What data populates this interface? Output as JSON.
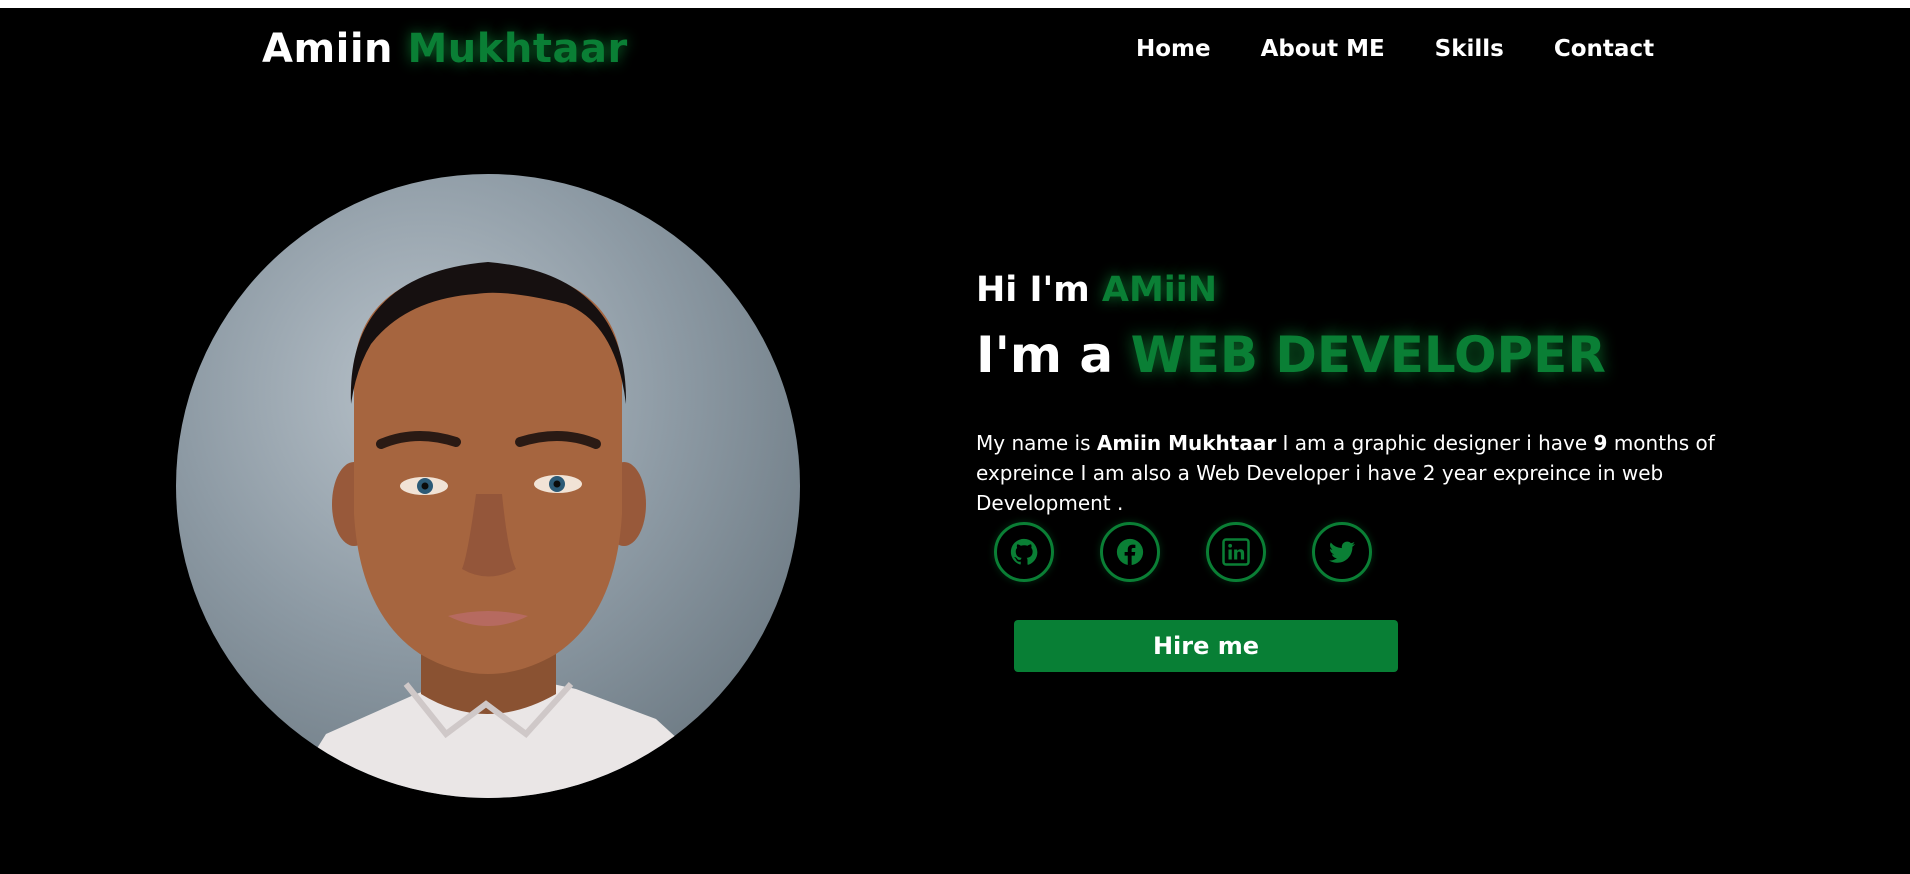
{
  "header": {
    "logo_first": "Amiin",
    "logo_last": "Mukhtaar",
    "nav": [
      {
        "label": "Home"
      },
      {
        "label": "About ME"
      },
      {
        "label": "Skills"
      },
      {
        "label": "Contact"
      }
    ]
  },
  "hero": {
    "greeting_prefix": "Hi I'm",
    "greeting_name": "AMiiN",
    "role_prefix": "I'm a",
    "role_title": "WEB DEVELOPER",
    "bio": {
      "part1": "My name is ",
      "name": "Amiin Mukhtaar",
      "part2": " I am a graphic designer i have ",
      "months": "9",
      "part3": " months of expreince I am also a Web Developer i have 2 year expreince in web Development ."
    },
    "socials": [
      {
        "icon": "github-icon"
      },
      {
        "icon": "facebook-icon"
      },
      {
        "icon": "linkedin-icon"
      },
      {
        "icon": "twitter-icon"
      }
    ],
    "hire_label": "Hire me"
  },
  "colors": {
    "background": "#000000",
    "accent": "#0a7f35",
    "text": "#ffffff"
  }
}
